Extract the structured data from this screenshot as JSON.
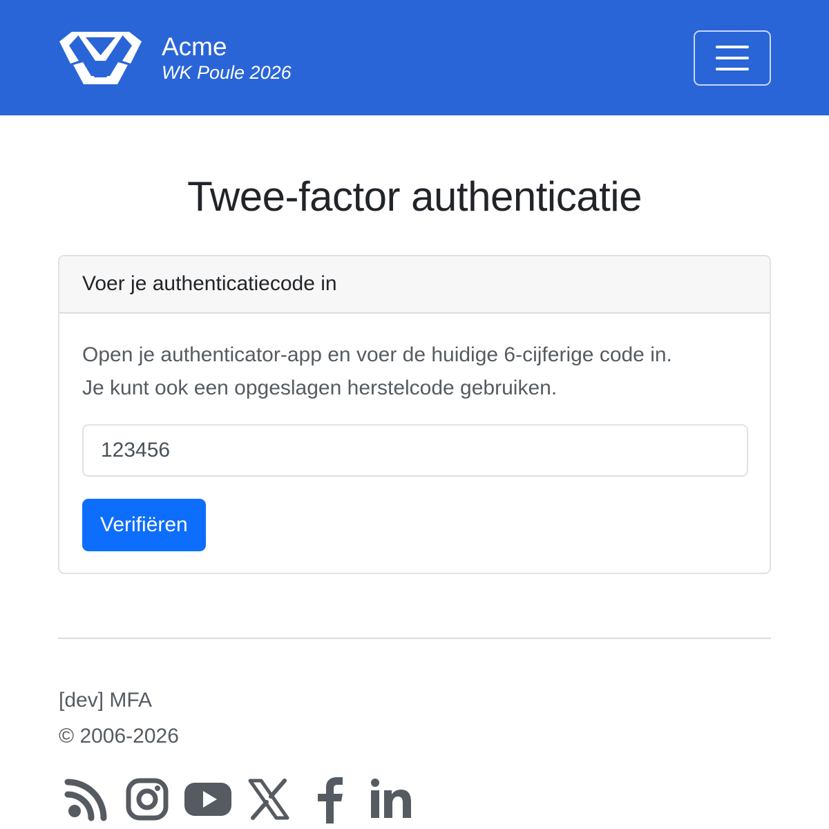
{
  "navbar": {
    "brand_name": "Acme",
    "brand_subtitle": "WK Poule 2026",
    "menu_toggle_icon": "hamburger-icon",
    "logo_icon": "acme-trophy-logo"
  },
  "page": {
    "title": "Twee-factor authenticatie"
  },
  "card": {
    "header": "Voer je authenticatiecode in",
    "intro_line1": "Open je authenticator-app en voer de huidige 6-cijferige code in.",
    "intro_line2": "Je kunt ook een opgeslagen herstelcode gebruiken.",
    "code_value": "123456",
    "verify_label": "Verifiëren"
  },
  "footer": {
    "env_label": "[dev] MFA",
    "copyright": "© 2006-2026",
    "social": [
      "rss-icon",
      "instagram-icon",
      "youtube-icon",
      "x-icon",
      "facebook-icon",
      "linkedin-icon"
    ]
  },
  "colors": {
    "navbar_bg": "#2a65d7",
    "primary_button": "#0d6efd",
    "muted_text": "#555b61",
    "icon_gray": "#555b61"
  }
}
